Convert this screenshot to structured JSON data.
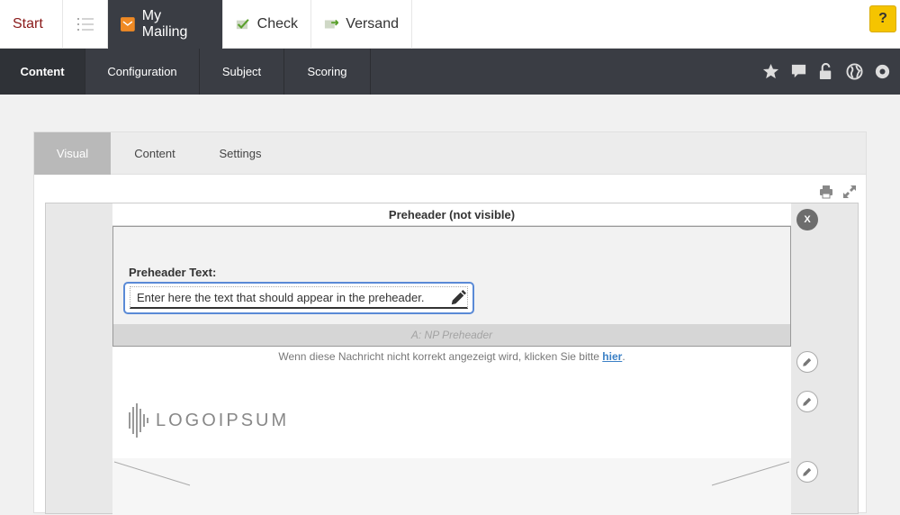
{
  "topbar": {
    "start": "Start",
    "my_mailing": "My Mailing",
    "check": "Check",
    "versand": "Versand",
    "help": "?"
  },
  "subnav": {
    "tabs": [
      {
        "label": "Content"
      },
      {
        "label": "Configuration"
      },
      {
        "label": "Subject"
      },
      {
        "label": "Scoring"
      }
    ],
    "icons": [
      "star-icon",
      "comment-icon",
      "unlock-icon",
      "globe-icon",
      "gear-icon"
    ]
  },
  "panel": {
    "tabs": [
      {
        "label": "Visual"
      },
      {
        "label": "Content"
      },
      {
        "label": "Settings"
      }
    ]
  },
  "editor": {
    "preheader_title": "Preheader (not visible)",
    "preheader_label": "Preheader Text:",
    "preheader_value": "Enter here the text that should appear in the preheader.",
    "module_name": "A: NP Preheader",
    "webview_text": "Wenn diese Nachricht nicht korrekt angezeigt wird, klicken Sie bitte ",
    "webview_link": "hier",
    "webview_end": ".",
    "logo_text": "LOGOIPSUM",
    "close_label": "X"
  },
  "colors": {
    "nav_dark": "#3a3d44",
    "help_yellow": "#f5c400",
    "field_border": "#5a8ad6",
    "link_blue": "#3b80c6"
  }
}
